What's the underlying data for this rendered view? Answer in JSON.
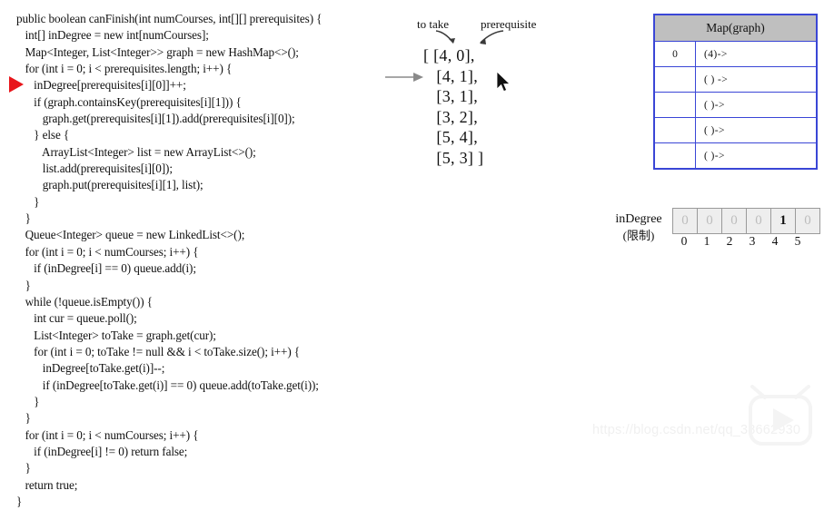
{
  "code": {
    "lines": [
      "public boolean canFinish(int numCourses, int[][] prerequisites) {",
      "   int[] inDegree = new int[numCourses];",
      "   Map<Integer, List<Integer>> graph = new HashMap<>();",
      "   for (int i = 0; i < prerequisites.length; i++) {",
      "      inDegree[prerequisites[i][0]]++;",
      "      if (graph.containsKey(prerequisites[i][1])) {",
      "         graph.get(prerequisites[i][1]).add(prerequisites[i][0]);",
      "      } else {",
      "         ArrayList<Integer> list = new ArrayList<>();",
      "         list.add(prerequisites[i][0]);",
      "         graph.put(prerequisites[i][1], list);",
      "      }",
      "   }",
      "   Queue<Integer> queue = new LinkedList<>();",
      "   for (int i = 0; i < numCourses; i++) {",
      "      if (inDegree[i] == 0) queue.add(i);",
      "   }",
      "   while (!queue.isEmpty()) {",
      "      int cur = queue.poll();",
      "      List<Integer> toTake = graph.get(cur);",
      "      for (int i = 0; toTake != null && i < toTake.size(); i++) {",
      "         inDegree[toTake.get(i)]--;",
      "         if (inDegree[toTake.get(i)] == 0) queue.add(toTake.get(i));",
      "      }",
      "   }",
      "   for (int i = 0; i < numCourses; i++) {",
      "      if (inDegree[i] != 0) return false;",
      "   }",
      "   return true;",
      "}"
    ],
    "pointer_line_index": 4,
    "pointer_color": "#e8161b"
  },
  "annotations": {
    "to_take_label": "to take",
    "prerequisite_label": "prerequisite",
    "step_arrow_color": "#8a8a8a"
  },
  "prerequisites": {
    "lines": [
      "[ [4, 0],",
      "   [4, 1],",
      "   [3, 1],",
      "   [3, 2],",
      "   [5, 4],",
      "   [5, 3] ]"
    ],
    "pairs": [
      [
        4,
        0
      ],
      [
        4,
        1
      ],
      [
        3,
        1
      ],
      [
        3,
        2
      ],
      [
        5,
        4
      ],
      [
        5,
        3
      ]
    ]
  },
  "map_table": {
    "title": "Map(graph)",
    "header_bg": "#bfbfbf",
    "border_color": "#3a46d6",
    "rows": [
      {
        "key": "0",
        "value": "(4)->"
      },
      {
        "key": "",
        "value": "( ) ->"
      },
      {
        "key": "",
        "value": "( )->"
      },
      {
        "key": "",
        "value": "( )->"
      },
      {
        "key": "",
        "value": "( )->"
      }
    ]
  },
  "in_degree": {
    "label": "inDegree",
    "label_zh": "(限制)",
    "values": [
      "0",
      "0",
      "0",
      "0",
      "1",
      "0"
    ],
    "indices": [
      "0",
      "1",
      "2",
      "3",
      "4",
      "5"
    ],
    "highlight_index": 4,
    "cell_bg": "#eeeeee",
    "cell_border": "#9a9a9a"
  },
  "watermark": {
    "text": "https://blog.csdn.net/qq_38662930",
    "logo_name": "csdn-play-logo"
  }
}
